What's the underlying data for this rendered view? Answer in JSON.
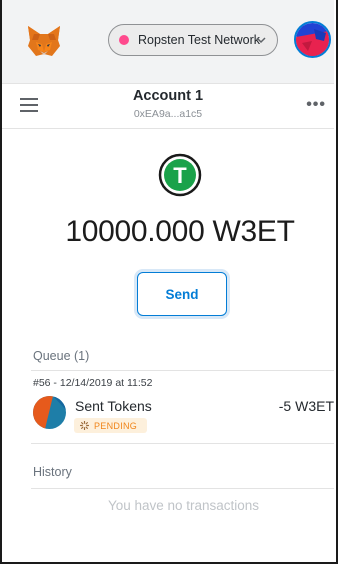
{
  "header": {
    "network_label": "Ropsten Test Network",
    "network_color": "#ff4a8d"
  },
  "account": {
    "name": "Account 1",
    "address": "0xEA9a...a1c5"
  },
  "balance": {
    "amount": "10000.000",
    "symbol": "W3ET",
    "token_icon_letter": "T",
    "token_color": "#1aa24a"
  },
  "actions": {
    "send_label": "Send"
  },
  "queue": {
    "label": "Queue (1)",
    "items": [
      {
        "date": "#56 - 12/14/2019 at 11:52",
        "title": "Sent Tokens",
        "amount": "-5 W3ET",
        "status": "PENDING"
      }
    ]
  },
  "history": {
    "label": "History",
    "empty_message": "You have no transactions"
  },
  "colors": {
    "accent": "#037dd6",
    "pending_bg": "#fdf0dc",
    "pending_text": "#f0851a"
  }
}
